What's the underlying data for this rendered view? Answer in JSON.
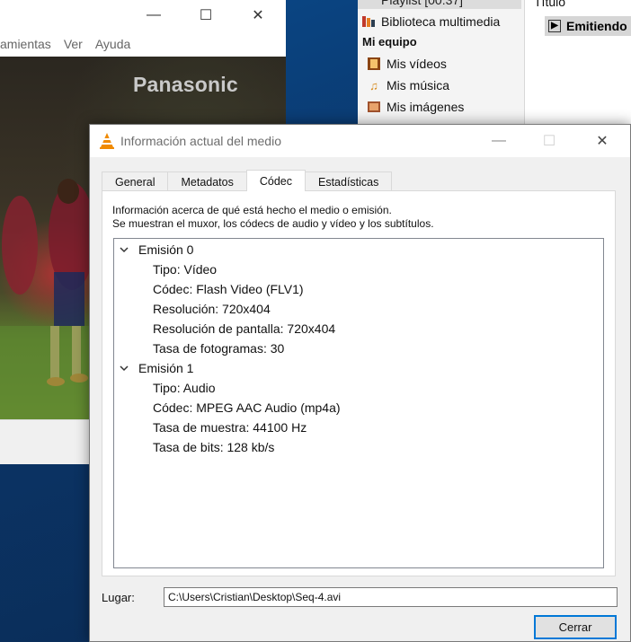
{
  "main_window": {
    "menu": [
      "amientas",
      "Ver",
      "Ayuda"
    ],
    "video_brand": "Panasonic"
  },
  "playlist": {
    "top_item": "Playlist [00:37]",
    "items": [
      {
        "label": "Biblioteca multimedia",
        "icon": "library-icon"
      },
      {
        "label": "Mis vídeos",
        "icon": "film-icon"
      },
      {
        "label": "Mis música",
        "icon": "music-icon"
      },
      {
        "label": "Mis imágenes",
        "icon": "image-icon"
      }
    ],
    "section": "Mi equipo",
    "column_title": "Título",
    "current_item": "Emitiendo"
  },
  "dialog": {
    "title": "Información actual del medio",
    "tabs": [
      "General",
      "Metadatos",
      "Códec",
      "Estadísticas"
    ],
    "active_tab": "Códec",
    "description_line1": "Información acerca de qué está hecho el medio o emisión.",
    "description_line2": "Se muestran el muxor, los códecs de audio y vídeo y los subtítulos.",
    "streams": [
      {
        "label": "Emisión 0",
        "details": [
          "Tipo: Vídeo",
          "Códec: Flash Video (FLV1)",
          "Resolución: 720x404",
          "Resolución de pantalla: 720x404",
          "Tasa de fotogramas: 30"
        ]
      },
      {
        "label": "Emisión 1",
        "details": [
          "Tipo: Audio",
          "Códec: MPEG AAC Audio (mp4a)",
          "Tasa de muestra: 44100 Hz",
          "Tasa de bits: 128 kb/s"
        ]
      }
    ],
    "location_label": "Lugar:",
    "location_value": "C:\\Users\\Cristian\\Desktop\\Seq-4.avi",
    "close_button": "Cerrar"
  }
}
